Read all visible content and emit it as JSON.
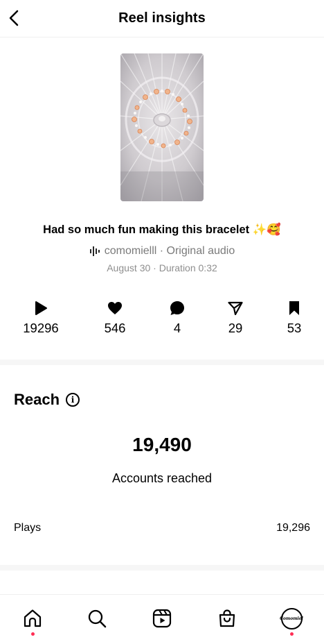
{
  "header": {
    "title": "Reel insights",
    "back_icon": "chevron-left-icon"
  },
  "reel": {
    "caption": "Had so much fun making this bracelet ✨🥰",
    "audio_label": "comomielll · Original audio",
    "meta": "August 30 · Duration 0:32"
  },
  "stats": [
    {
      "icon": "play-icon",
      "value": "19296"
    },
    {
      "icon": "heart-icon",
      "value": "546"
    },
    {
      "icon": "comment-icon",
      "value": "4"
    },
    {
      "icon": "share-icon",
      "value": "29"
    },
    {
      "icon": "bookmark-icon",
      "value": "53"
    }
  ],
  "reach": {
    "title": "Reach",
    "accounts_reached": "19,490",
    "accounts_label": "Accounts reached",
    "rows": [
      {
        "label": "Plays",
        "value": "19,296"
      }
    ]
  },
  "tabbar": {
    "tabs": [
      "home",
      "search",
      "reels",
      "shop",
      "profile"
    ],
    "profile_avatar_text": "Comomiel",
    "indicator_color": "#ff2e55"
  }
}
